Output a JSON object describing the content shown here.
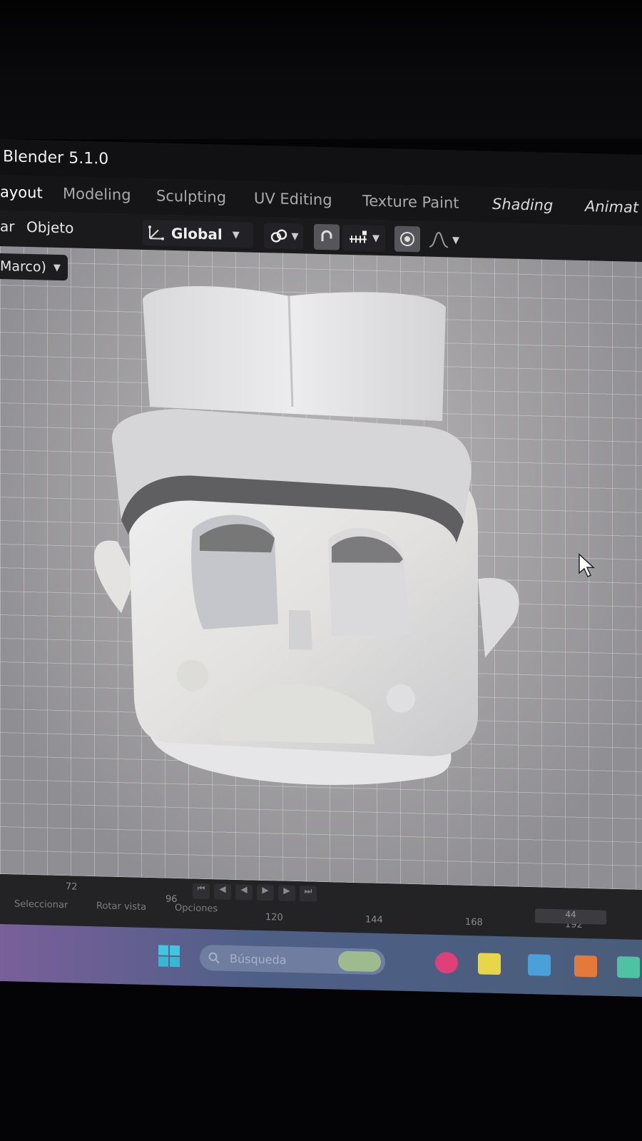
{
  "window": {
    "title": "Blender 5.1.0"
  },
  "workspace_tabs": [
    {
      "label": "ayout"
    },
    {
      "label": "Modeling"
    },
    {
      "label": "Sculpting"
    },
    {
      "label": "UV Editing"
    },
    {
      "label": "Texture Paint"
    },
    {
      "label": "Shading"
    },
    {
      "label": "Animat"
    }
  ],
  "header": {
    "menu_left": "ar",
    "menu_object": "Objeto",
    "orientation": "Global"
  },
  "viewport": {
    "collection_label": "Marco)"
  },
  "timeline": {
    "frame_ticks": [
      "72",
      "96",
      "120",
      "144",
      "168",
      "192"
    ],
    "status_items": [
      "Seleccionar",
      "Rotar vista",
      "Opciones"
    ],
    "current_frame": "44"
  },
  "taskbar": {
    "search_placeholder": "Búsqueda"
  },
  "colors": {
    "accent": "#4772b3",
    "titlebar": "#111114",
    "taskbar": "#6a5f93"
  }
}
